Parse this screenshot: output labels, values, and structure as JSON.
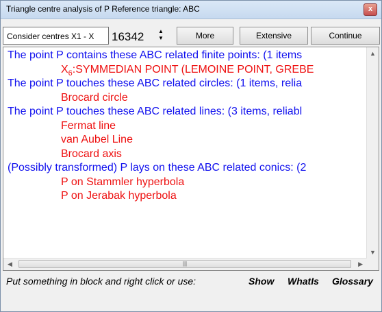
{
  "window": {
    "title": "Triangle centre analysis of P    Reference triangle: ABC",
    "close_label": "x"
  },
  "toolbar": {
    "consider_label": "Consider centres X1 - X",
    "spin_value": "16342",
    "more": "More",
    "extensive": "Extensive",
    "continue": "Continue"
  },
  "content": {
    "l1": "The point P contains these ABC related finite points: (1 items",
    "l2_main": "X",
    "l2_sub": "6",
    "l2_rest": ":SYMMEDIAN POINT (LEMOINE POINT, GREBE",
    "l3": "The point P touches these ABC related circles: (1 items, relia",
    "l4": "Brocard circle",
    "l5": "The point P touches these ABC related lines: (3 items, reliabl",
    "l6": "Fermat line",
    "l7": "van Aubel Line",
    "l8": "Brocard axis",
    "l9": "(Possibly transformed) P lays on these ABC related conics: (2",
    "l10": "P on Stammler hyperbola",
    "l11": "P on Jerabak hyperbola"
  },
  "status": {
    "hint": "Put something in block and right click or use:",
    "show": "Show",
    "whatis": "WhatIs",
    "glossary": "Glossary"
  }
}
